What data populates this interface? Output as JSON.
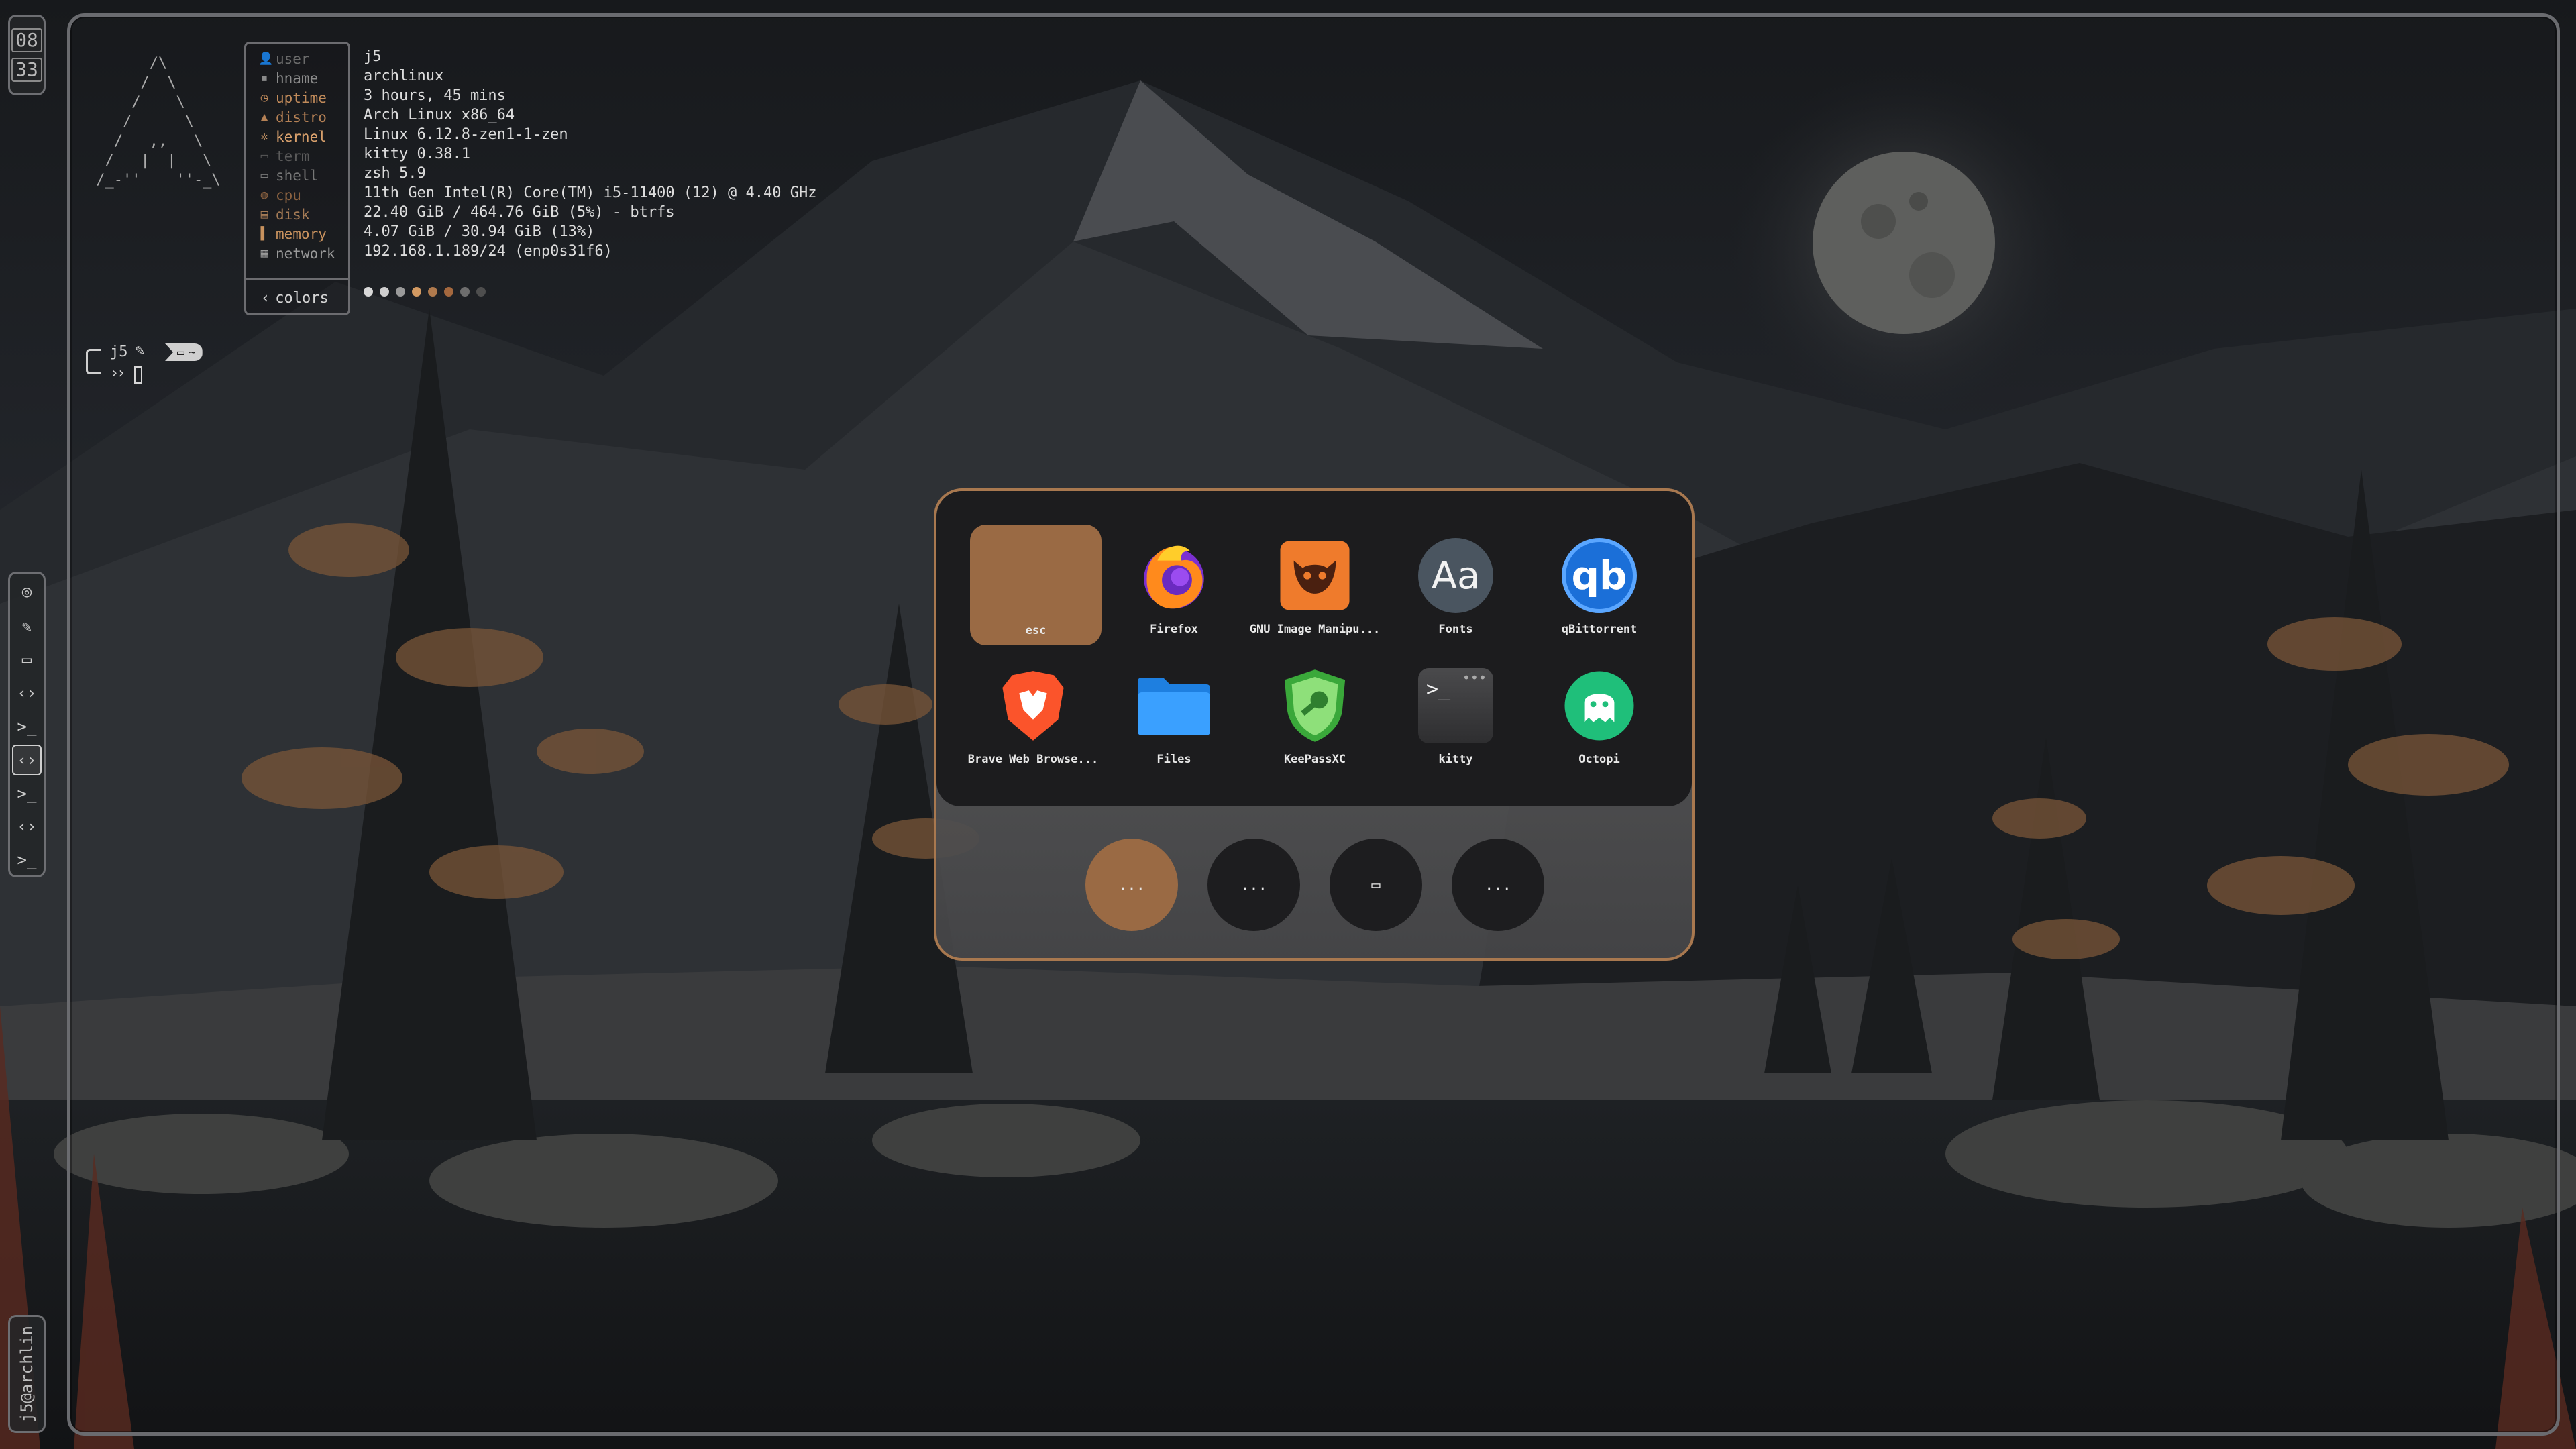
{
  "clock": {
    "hour": "08",
    "minute": "33"
  },
  "sidebar": {
    "workspaces": [
      {
        "icon": "github-icon",
        "glyph": "⌾"
      },
      {
        "icon": "brush-icon",
        "glyph": "✎"
      },
      {
        "icon": "folder-icon",
        "glyph": "▭"
      },
      {
        "icon": "code-icon",
        "glyph": "‹›"
      },
      {
        "icon": "terminal-icon",
        "glyph": ">_"
      },
      {
        "icon": "code-icon",
        "glyph": "‹›"
      },
      {
        "icon": "terminal-icon",
        "glyph": ">_"
      },
      {
        "icon": "code-icon",
        "glyph": "‹›"
      },
      {
        "icon": "terminal-icon",
        "glyph": ">_"
      }
    ],
    "active_index": 5,
    "user_label": "j5@archlin"
  },
  "fastfetch": {
    "ascii": "       /\\\n      /  \\\n     /    \\\n    /      \\\n   /   ,,   \\\n  /   |  |   \\\n /_-''    ''-_\\",
    "rows": [
      {
        "key": "user",
        "value": "j5",
        "color": "#6b6b6b"
      },
      {
        "key": "hname",
        "value": "archlinux",
        "color": "#8a8a8a"
      },
      {
        "key": "uptime",
        "value": "3 hours, 45 mins",
        "color": "#c08a5a"
      },
      {
        "key": "distro",
        "value": "Arch Linux x86_64",
        "color": "#b58155"
      },
      {
        "key": "kernel",
        "value": "Linux 6.12.8-zen1-1-zen",
        "color": "#d8a06c"
      },
      {
        "key": "term",
        "value": "kitty 0.38.1",
        "color": "#5a5a5a"
      },
      {
        "key": "shell",
        "value": "zsh 5.9",
        "color": "#777777"
      },
      {
        "key": "cpu",
        "value": "11th Gen Intel(R) Core(TM) i5-11400 (12) @ 4.40 GHz",
        "color": "#8a6140"
      },
      {
        "key": "disk",
        "value": "22.40 GiB / 464.76 GiB (5%) - btrfs",
        "color": "#a47a55"
      },
      {
        "key": "memory",
        "value": "4.07 GiB / 30.94 GiB (13%)",
        "color": "#c8925e"
      },
      {
        "key": "network",
        "value": "192.168.1.189/24 (enp0s31f6)",
        "color": "#9a9a9a"
      }
    ],
    "colors_label": "colors",
    "palette": [
      "#d8d8d8",
      "#cfcfcf",
      "#9a9a9a",
      "#d39a62",
      "#b07a4d",
      "#a4683e",
      "#6e6e6e",
      "#4e4e4e"
    ]
  },
  "prompt": {
    "user": "j5",
    "dir": "~",
    "arrow": "››"
  },
  "launcher": {
    "apps": [
      {
        "name": "esc",
        "icon": "esc-tile"
      },
      {
        "name": "Firefox",
        "icon": "firefox-icon"
      },
      {
        "name": "GNU Image Manipu...",
        "icon": "gimp-icon"
      },
      {
        "name": "Fonts",
        "icon": "fonts-icon"
      },
      {
        "name": "qBittorrent",
        "icon": "qbittorrent-icon"
      },
      {
        "name": "Brave Web Browse...",
        "icon": "brave-icon"
      },
      {
        "name": "Files",
        "icon": "files-icon"
      },
      {
        "name": "KeePassXC",
        "icon": "keepassxc-icon"
      },
      {
        "name": "kitty",
        "icon": "kitty-icon"
      },
      {
        "name": "Octopi",
        "icon": "octopi-icon"
      }
    ],
    "fonts_glyph": "Aa",
    "qb_glyph": "qb",
    "kitty_glyph": ">_",
    "quick_buttons": [
      "...",
      "...",
      "▭",
      "..."
    ],
    "accent": "#9a6a44",
    "border": "#a8784f"
  }
}
